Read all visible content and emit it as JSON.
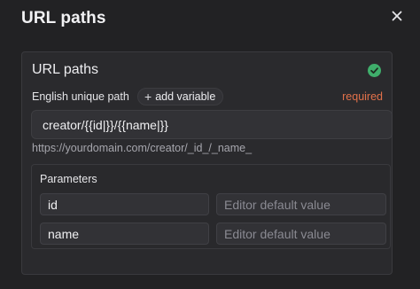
{
  "dialog": {
    "title": "URL paths",
    "close_icon": "close-icon"
  },
  "panel": {
    "title": "URL paths",
    "status_icon": "check-circle-icon",
    "status_color": "#3fae6b",
    "field_label": "English unique path",
    "add_variable_label": "add variable",
    "required_label": "required",
    "required_color": "#e2714a",
    "path_value": "creator/{{id|}}/{{name|}}",
    "url_preview": "https://yourdomain.com/creator/_id_/_name_"
  },
  "parameters": {
    "title": "Parameters",
    "rows": [
      {
        "name": "id",
        "default_placeholder": "Editor default value"
      },
      {
        "name": "name",
        "default_placeholder": "Editor default value"
      }
    ]
  }
}
